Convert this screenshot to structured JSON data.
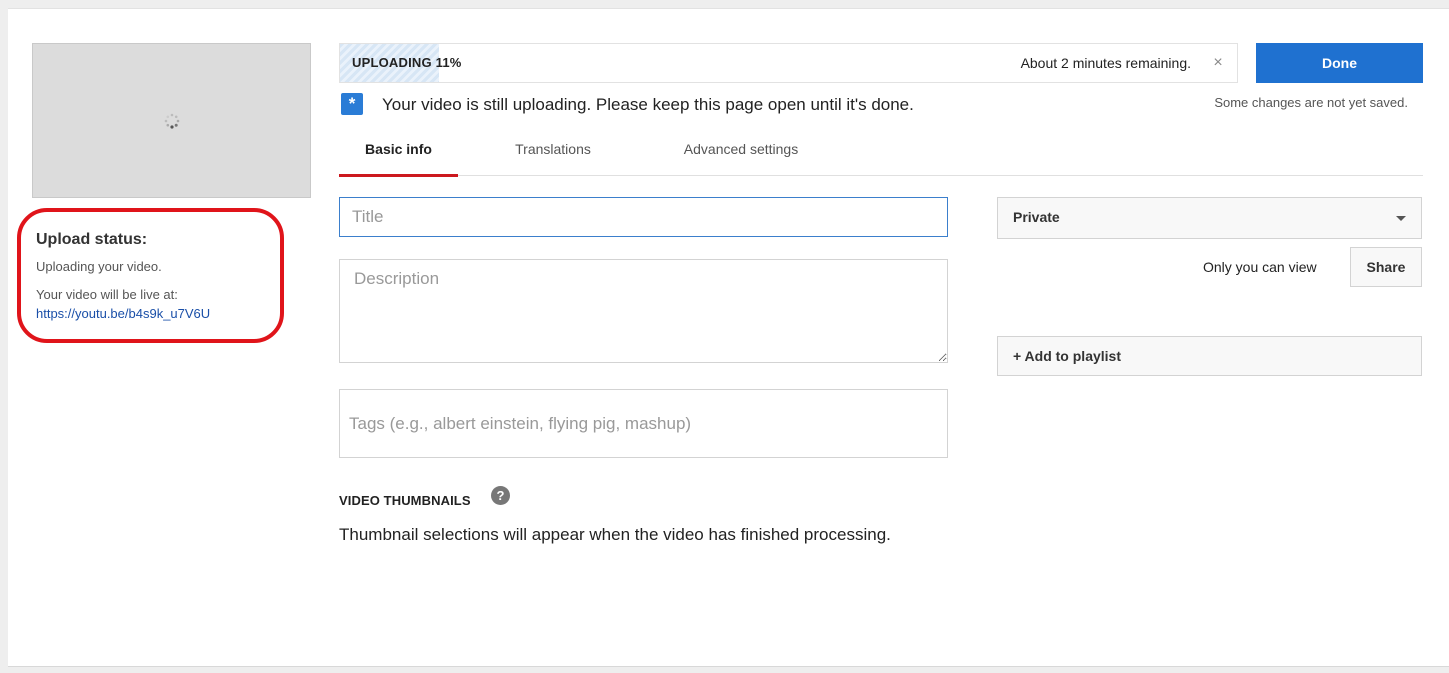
{
  "upload": {
    "progress_label": "UPLOADING 11%",
    "progress_fraction": 0.11,
    "remaining": "About 2 minutes remaining.",
    "close_glyph": "×",
    "done_label": "Done",
    "not_saved": "Some changes are not yet saved.",
    "notice": "Your video is still uploading. Please keep this page open until it's done.",
    "notice_icon": "star-icon"
  },
  "status": {
    "title": "Upload status:",
    "text": "Uploading your video.",
    "live_label": "Your video will be live at:",
    "link": "https://youtu.be/b4s9k_u7V6U"
  },
  "tabs": [
    {
      "label": "Basic info",
      "active": true
    },
    {
      "label": "Translations",
      "active": false
    },
    {
      "label": "Advanced settings",
      "active": false
    }
  ],
  "form": {
    "title_placeholder": "Title",
    "description_placeholder": "Description",
    "tags_placeholder": "Tags (e.g., albert einstein, flying pig, mashup)"
  },
  "thumbnails": {
    "heading": "VIDEO THUMBNAILS",
    "help_glyph": "?",
    "text": "Thumbnail selections will appear when the video has finished processing."
  },
  "privacy": {
    "selected": "Private",
    "description": "Only you can view",
    "share_label": "Share",
    "playlist_label": "+ Add to playlist"
  },
  "colors": {
    "accent_blue": "#1f71d0",
    "tab_underline": "#cc181e",
    "highlight_red": "#e0141a",
    "link_blue": "#1a4fa8"
  }
}
